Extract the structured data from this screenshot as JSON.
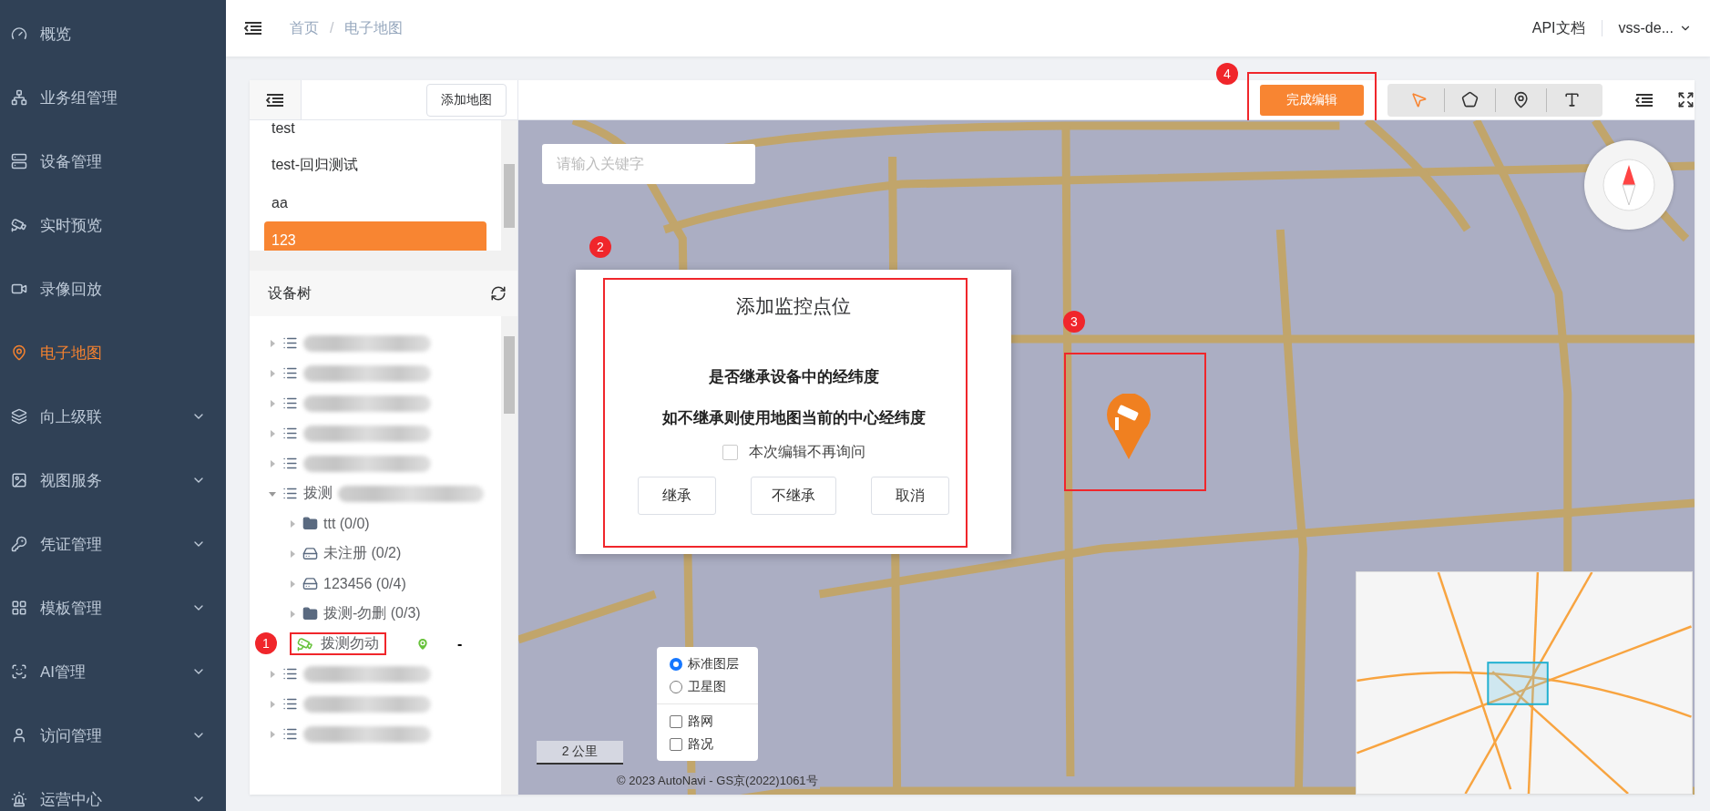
{
  "sidebar": {
    "items": [
      {
        "label": "概览",
        "kind": "link",
        "selected": false
      },
      {
        "label": "业务组管理",
        "kind": "link",
        "selected": false
      },
      {
        "label": "设备管理",
        "kind": "link",
        "selected": false
      },
      {
        "label": "实时预览",
        "kind": "link",
        "selected": false
      },
      {
        "label": "录像回放",
        "kind": "link",
        "selected": false
      },
      {
        "label": "电子地图",
        "kind": "link",
        "selected": true
      },
      {
        "label": "向上级联",
        "kind": "submenu",
        "selected": false
      },
      {
        "label": "视图服务",
        "kind": "submenu",
        "selected": false
      },
      {
        "label": "凭证管理",
        "kind": "submenu",
        "selected": false
      },
      {
        "label": "模板管理",
        "kind": "submenu",
        "selected": false
      },
      {
        "label": "AI管理",
        "kind": "submenu",
        "selected": false
      },
      {
        "label": "访问管理",
        "kind": "submenu",
        "selected": false
      },
      {
        "label": "运营中心",
        "kind": "submenu",
        "selected": false
      }
    ]
  },
  "header": {
    "breadcrumb": [
      "首页",
      "电子地图"
    ],
    "separator": "/",
    "api_link": "API文档",
    "user": "vss-de..."
  },
  "toolbar": {
    "add_map_button": "添加地图",
    "finish_button": "完成编辑",
    "tools": [
      {
        "selected": true
      },
      {
        "selected": false
      },
      {
        "selected": false
      },
      {
        "selected": false
      }
    ]
  },
  "map_list": {
    "items": [
      {
        "label": "test",
        "selected": false
      },
      {
        "label": "test-回归测试",
        "selected": false
      },
      {
        "label": "aa",
        "selected": false
      },
      {
        "label": "123",
        "selected": true
      }
    ]
  },
  "device_tree": {
    "title": "设备树",
    "nodes": [
      {
        "kind": "group",
        "redacted": true,
        "expanded": false
      },
      {
        "kind": "group",
        "redacted": true,
        "expanded": false
      },
      {
        "kind": "group",
        "redacted": true,
        "expanded": false
      },
      {
        "kind": "group",
        "redacted": true,
        "expanded": false
      },
      {
        "kind": "group",
        "redacted": true,
        "expanded": false
      },
      {
        "kind": "group",
        "label": "拨测",
        "redacted": true,
        "expanded": true,
        "children": [
          {
            "kind": "folder",
            "label": "ttt (0/0)",
            "expanded": false
          },
          {
            "kind": "nvr",
            "label": "未注册 (0/2)",
            "expanded": false
          },
          {
            "kind": "nvr",
            "label": "123456 (0/4)",
            "expanded": false
          },
          {
            "kind": "folder",
            "label": "拨测-勿删 (0/3)",
            "expanded": false
          },
          {
            "kind": "camera",
            "label": "拨测勿动",
            "located": true,
            "value": "-"
          }
        ]
      },
      {
        "kind": "group",
        "redacted": true,
        "expanded": false
      },
      {
        "kind": "group",
        "redacted": true,
        "expanded": false
      },
      {
        "kind": "group",
        "redacted": true,
        "expanded": false
      }
    ]
  },
  "map": {
    "search": {
      "placeholder": "请输入关键字"
    },
    "layers": [
      {
        "kind": "radio",
        "label": "标准图层",
        "selected": true
      },
      {
        "kind": "radio",
        "label": "卫星图",
        "selected": false
      },
      {
        "kind": "checkbox",
        "label": "路网",
        "checked": false
      },
      {
        "kind": "checkbox",
        "label": "路况",
        "checked": false
      }
    ],
    "scale": "2 公里",
    "copyright": "© 2023 AutoNavi - GS京(2022)1061号"
  },
  "dialog": {
    "title": "添加监控点位",
    "messages": [
      "是否继承设备中的经纬度",
      "如不继承则使用地图当前的中心经纬度"
    ],
    "checkbox": {
      "label": "本次编辑不再询问",
      "checked": false
    },
    "buttons": [
      "继承",
      "不继承",
      "取消"
    ]
  },
  "annotations": [
    "1",
    "2",
    "3",
    "4"
  ]
}
